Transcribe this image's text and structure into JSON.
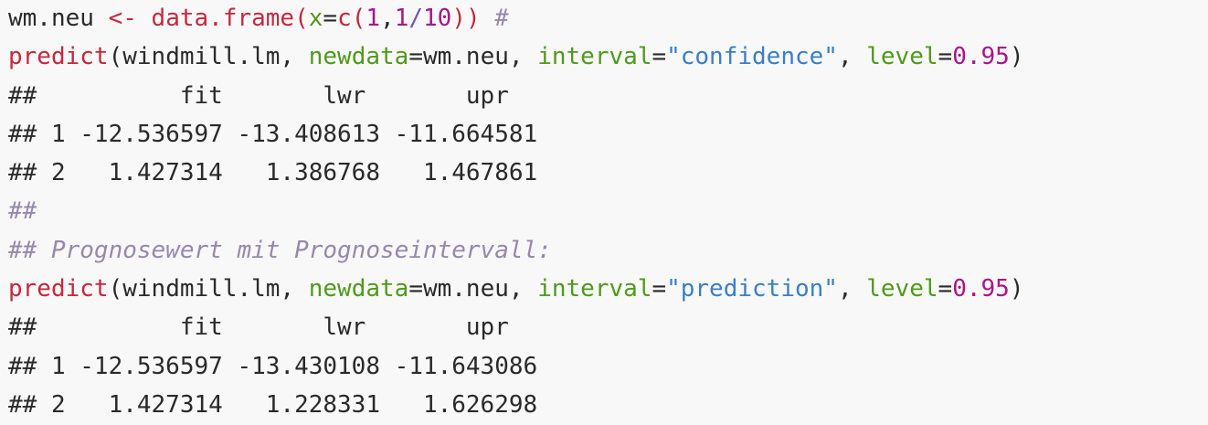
{
  "code": {
    "line1": {
      "var": "wm.neu ",
      "arrow": "<-",
      "space1": " ",
      "fn": "data.frame",
      "paren_open": "(",
      "arg": "x",
      "eq": "=",
      "fn2": "c",
      "p2": "(",
      "n1": "1",
      "comma": ",",
      "n2": "1",
      "slash": "/",
      "n3": "10",
      "close": "))",
      "space2": " ",
      "comment": "#"
    },
    "line2": {
      "fn": "predict",
      "open": "(windmill.lm, ",
      "arg1": "newdata",
      "eq1": "=",
      "val1": "wm.neu, ",
      "arg2": "interval",
      "eq2": "=",
      "str": "\"confidence\"",
      "sep": ", ",
      "arg3": "level",
      "eq3": "=",
      "num": "0.95",
      "close": ")"
    },
    "out1_header": "##          fit       lwr       upr",
    "out1_row1": "## 1 -12.536597 -13.408613 -11.664581",
    "out1_row2": "## 2   1.427314   1.386768   1.467861",
    "comment1": "##",
    "comment2": "## Prognosewert mit Prognoseintervall:",
    "line8": {
      "fn": "predict",
      "open": "(windmill.lm, ",
      "arg1": "newdata",
      "eq1": "=",
      "val1": "wm.neu, ",
      "arg2": "interval",
      "eq2": "=",
      "str": "\"prediction\"",
      "sep": ", ",
      "arg3": "level",
      "eq3": "=",
      "num": "0.95",
      "close": ")"
    },
    "out2_header": "##          fit       lwr       upr",
    "out2_row1": "## 1 -12.536597 -13.430108 -11.643086",
    "out2_row2": "## 2   1.427314   1.228331   1.626298"
  }
}
